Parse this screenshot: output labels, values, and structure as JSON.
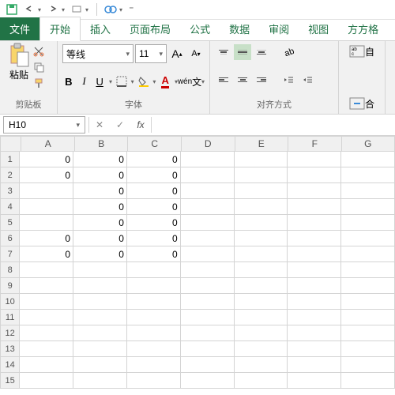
{
  "qat": {
    "save": "save",
    "undo": "undo",
    "redo": "redo",
    "custom": "custom",
    "touch": "touch"
  },
  "tabs": {
    "file": "文件",
    "home": "开始",
    "insert": "插入",
    "layout": "页面布局",
    "formula": "公式",
    "data": "数据",
    "review": "审阅",
    "view": "视图",
    "dev": "方方格"
  },
  "ribbon": {
    "clipboard_label": "剪贴板",
    "paste": "粘贴",
    "font_label": "字体",
    "font_name": "等线",
    "font_size": "11",
    "bold": "B",
    "italic": "I",
    "underline": "U",
    "wen": "wén",
    "align_label": "对齐方式",
    "merge": "合"
  },
  "namebox": "H10",
  "fx": "fx",
  "columns": [
    "A",
    "B",
    "C",
    "D",
    "E",
    "F",
    "G"
  ],
  "rows": [
    "1",
    "2",
    "3",
    "4",
    "5",
    "6",
    "7",
    "8",
    "9",
    "10",
    "11",
    "12",
    "13",
    "14",
    "15"
  ],
  "cells": {
    "A1": "0",
    "B1": "0",
    "C1": "0",
    "A2": "0",
    "B2": "0",
    "C2": "0",
    "B3": "0",
    "C3": "0",
    "B4": "0",
    "C4": "0",
    "B5": "0",
    "C5": "0",
    "A6": "0",
    "B6": "0",
    "C6": "0",
    "A7": "0",
    "B7": "0",
    "C7": "0"
  }
}
